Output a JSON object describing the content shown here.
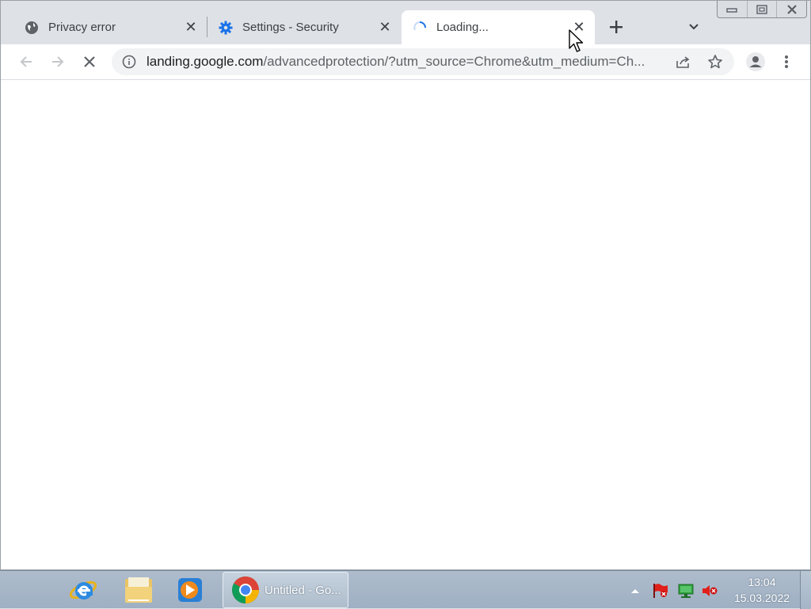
{
  "browser": {
    "tabs": [
      {
        "title": "Privacy error",
        "active": false
      },
      {
        "title": "Settings - Security",
        "active": false
      },
      {
        "title": "Loading...",
        "active": true
      }
    ],
    "address_bar": {
      "host": "landing.google.com",
      "path": "/advancedprotection/?utm_source=Chrome&utm_medium=Ch..."
    }
  },
  "taskbar": {
    "chrome_button_label": "Untitled - Go...",
    "clock": {
      "time": "13:04",
      "date": "15.03.2022"
    }
  },
  "colors": {
    "accent_blue": "#1a73e8",
    "tab_strip": "#dee1e6"
  }
}
